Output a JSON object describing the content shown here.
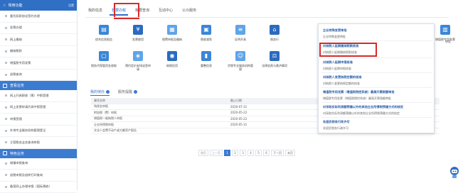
{
  "sidebar": {
    "header_title": "常用功能",
    "header_more": "设置",
    "group1": [
      "委托扣款协议签约办理",
      "发票办理",
      "网上缴纳",
      "缴纳税款",
      "增值税专用发票",
      "退税查询"
    ],
    "section2": "查看业务",
    "group2": [
      "网上开具税收（票）中报受理",
      "网上发票申请开具中报受理",
      "申报受理",
      "外地专业服务机构管理登记",
      "主营税务业务查询申报"
    ],
    "section3": "特色业务",
    "group3": [
      "城镇申报查询",
      "退税申报及退库打印查询",
      "备案网上办理申报（国际税收）"
    ]
  },
  "tabs": [
    "我的信息",
    "我要办税",
    "我要查询",
    "互动中心",
    "公众服务"
  ],
  "icons_row1": [
    "综合信息报告",
    "发票使用",
    "税费申报及缴纳",
    "税收减免",
    "证明开具",
    "税务行",
    "增值税专用发票"
  ],
  "icons_row2": [
    "税务代保管资金收取",
    "预约定价安排谈签申请",
    "纳税信用",
    "重整信息",
    "涉税专业服务机构管理",
    "法律追责与救济事项"
  ],
  "edge_label": "申证",
  "table_tabs": {
    "todo": "我的待办",
    "service": "服务提醒"
  },
  "table": {
    "headers": [
      "事项名称",
      "截止日期",
      "操作"
    ],
    "rows": [
      [
        "残保金申报",
        "2020-07-31",
        "立即办理"
      ],
      [
        "附加税（费）申报",
        "2020-05-22",
        "立即办理"
      ],
      [
        "增值税一般纳税人申报",
        "2020-05-22",
        "立即办理"
      ],
      [
        "企业所得税申报",
        "2020-05-31",
        "立即办理"
      ],
      [
        "文化人会费不动产或大额资产报告",
        "",
        ""
      ]
    ]
  },
  "pager": {
    "first": "首页",
    "prev": "上一页",
    "pages": [
      "1",
      "2",
      "3",
      "4",
      "5",
      "6"
    ],
    "next": "下一页",
    "last": "末页"
  },
  "popup": {
    "h1": "企业特殊变更审批",
    "i1": "企业特殊变更审批",
    "h2": "对纳税人延期缴纳税款核准",
    "i2": "对纳税人延期缴纳税款核准",
    "h3": "对纳税人延期申报核准",
    "i3": "对纳税人延期申报核准",
    "h4": "对纳税人变更纳税定额的核准",
    "i4": "对纳税人变更纳税定额的核准",
    "h5": "增值税专用发票（增值税税控系统）最高开票限额审批",
    "i5": "增值税专用发票（增值税税控系统）最高开票限额审批",
    "h6": "对采取实际利润额预缴以外的其他企业所得税预缴方式的核定",
    "i6": "对采取实际利润额预缴以外的其他企业所得税预缴方式的核定",
    "h7": "非居民税务行政许可",
    "i7": "非居民税务行政许可"
  },
  "colors": {
    "accent": "#2f6fc4",
    "highlight": "#d62a2a"
  }
}
